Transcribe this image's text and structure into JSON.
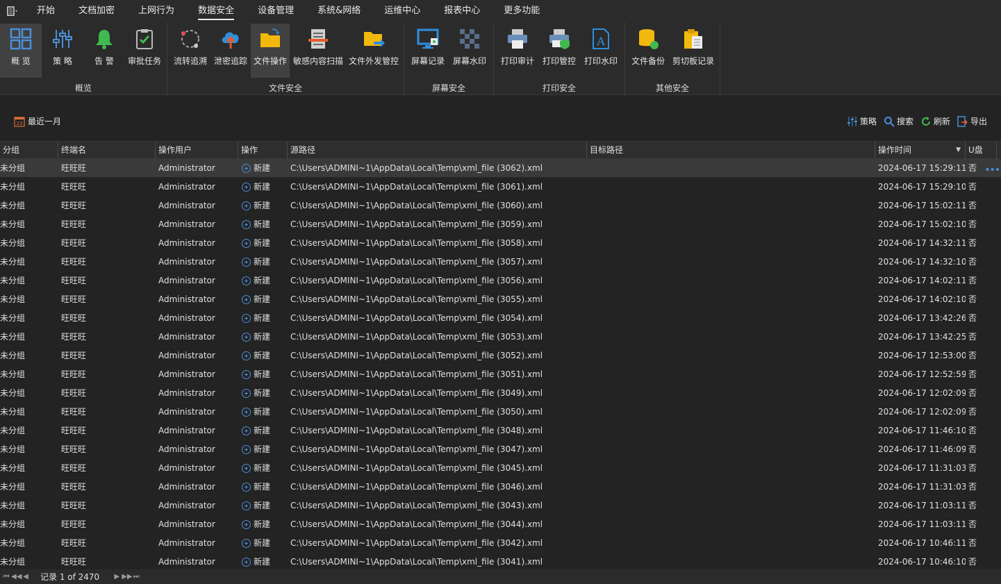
{
  "menubar": {
    "items": [
      "开始",
      "文档加密",
      "上网行为",
      "数据安全",
      "设备管理",
      "系统&网络",
      "运维中心",
      "报表中心",
      "更多功能"
    ],
    "active_index": 3
  },
  "ribbon": {
    "groups": [
      {
        "title": "概览"
      },
      {
        "title": "文件安全"
      },
      {
        "title": "屏幕安全"
      },
      {
        "title": "打印安全"
      },
      {
        "title": "其他安全"
      }
    ],
    "buttons": {
      "overview": "概 览",
      "policy": "策 略",
      "alert": "告 警",
      "approval": "审批任务",
      "flow_trace": "流转追溯",
      "leak_trace": "泄密追踪",
      "file_ops": "文件操作",
      "sensitive_scan": "敏感内容扫描",
      "file_outbound": "文件外发管控",
      "screen_record": "屏幕记录",
      "screen_watermark": "屏幕水印",
      "print_audit": "打印审计",
      "print_control": "打印管控",
      "print_watermark": "打印水印",
      "file_backup": "文件备份",
      "clipboard": "剪切板记录"
    }
  },
  "toolbar": {
    "date_range": "最近一月",
    "calendar_day": "23",
    "policy": "策略",
    "search": "搜索",
    "refresh": "刷新",
    "export": "导出"
  },
  "table": {
    "columns": [
      "分组",
      "终端名",
      "操作用户",
      "操作",
      "源路径",
      "目标路径",
      "操作时间",
      "U盘"
    ],
    "rows": [
      {
        "group": "未分组",
        "terminal": "旺旺旺",
        "user": "Administrator",
        "op": "新建",
        "src": "C:\\Users\\ADMINI~1\\AppData\\Local\\Temp\\xml_file (3062).xml",
        "dst": "",
        "time": "2024-06-17 15:29:11",
        "usb": "否"
      },
      {
        "group": "未分组",
        "terminal": "旺旺旺",
        "user": "Administrator",
        "op": "新建",
        "src": "C:\\Users\\ADMINI~1\\AppData\\Local\\Temp\\xml_file (3061).xml",
        "dst": "",
        "time": "2024-06-17 15:29:10",
        "usb": "否"
      },
      {
        "group": "未分组",
        "terminal": "旺旺旺",
        "user": "Administrator",
        "op": "新建",
        "src": "C:\\Users\\ADMINI~1\\AppData\\Local\\Temp\\xml_file (3060).xml",
        "dst": "",
        "time": "2024-06-17 15:02:11",
        "usb": "否"
      },
      {
        "group": "未分组",
        "terminal": "旺旺旺",
        "user": "Administrator",
        "op": "新建",
        "src": "C:\\Users\\ADMINI~1\\AppData\\Local\\Temp\\xml_file (3059).xml",
        "dst": "",
        "time": "2024-06-17 15:02:10",
        "usb": "否"
      },
      {
        "group": "未分组",
        "terminal": "旺旺旺",
        "user": "Administrator",
        "op": "新建",
        "src": "C:\\Users\\ADMINI~1\\AppData\\Local\\Temp\\xml_file (3058).xml",
        "dst": "",
        "time": "2024-06-17 14:32:11",
        "usb": "否"
      },
      {
        "group": "未分组",
        "terminal": "旺旺旺",
        "user": "Administrator",
        "op": "新建",
        "src": "C:\\Users\\ADMINI~1\\AppData\\Local\\Temp\\xml_file (3057).xml",
        "dst": "",
        "time": "2024-06-17 14:32:10",
        "usb": "否"
      },
      {
        "group": "未分组",
        "terminal": "旺旺旺",
        "user": "Administrator",
        "op": "新建",
        "src": "C:\\Users\\ADMINI~1\\AppData\\Local\\Temp\\xml_file (3056).xml",
        "dst": "",
        "time": "2024-06-17 14:02:11",
        "usb": "否"
      },
      {
        "group": "未分组",
        "terminal": "旺旺旺",
        "user": "Administrator",
        "op": "新建",
        "src": "C:\\Users\\ADMINI~1\\AppData\\Local\\Temp\\xml_file (3055).xml",
        "dst": "",
        "time": "2024-06-17 14:02:10",
        "usb": "否"
      },
      {
        "group": "未分组",
        "terminal": "旺旺旺",
        "user": "Administrator",
        "op": "新建",
        "src": "C:\\Users\\ADMINI~1\\AppData\\Local\\Temp\\xml_file (3054).xml",
        "dst": "",
        "time": "2024-06-17 13:42:26",
        "usb": "否"
      },
      {
        "group": "未分组",
        "terminal": "旺旺旺",
        "user": "Administrator",
        "op": "新建",
        "src": "C:\\Users\\ADMINI~1\\AppData\\Local\\Temp\\xml_file (3053).xml",
        "dst": "",
        "time": "2024-06-17 13:42:25",
        "usb": "否"
      },
      {
        "group": "未分组",
        "terminal": "旺旺旺",
        "user": "Administrator",
        "op": "新建",
        "src": "C:\\Users\\ADMINI~1\\AppData\\Local\\Temp\\xml_file (3052).xml",
        "dst": "",
        "time": "2024-06-17 12:53:00",
        "usb": "否"
      },
      {
        "group": "未分组",
        "terminal": "旺旺旺",
        "user": "Administrator",
        "op": "新建",
        "src": "C:\\Users\\ADMINI~1\\AppData\\Local\\Temp\\xml_file (3051).xml",
        "dst": "",
        "time": "2024-06-17 12:52:59",
        "usb": "否"
      },
      {
        "group": "未分组",
        "terminal": "旺旺旺",
        "user": "Administrator",
        "op": "新建",
        "src": "C:\\Users\\ADMINI~1\\AppData\\Local\\Temp\\xml_file (3049).xml",
        "dst": "",
        "time": "2024-06-17 12:02:09",
        "usb": "否"
      },
      {
        "group": "未分组",
        "terminal": "旺旺旺",
        "user": "Administrator",
        "op": "新建",
        "src": "C:\\Users\\ADMINI~1\\AppData\\Local\\Temp\\xml_file (3050).xml",
        "dst": "",
        "time": "2024-06-17 12:02:09",
        "usb": "否"
      },
      {
        "group": "未分组",
        "terminal": "旺旺旺",
        "user": "Administrator",
        "op": "新建",
        "src": "C:\\Users\\ADMINI~1\\AppData\\Local\\Temp\\xml_file (3048).xml",
        "dst": "",
        "time": "2024-06-17 11:46:10",
        "usb": "否"
      },
      {
        "group": "未分组",
        "terminal": "旺旺旺",
        "user": "Administrator",
        "op": "新建",
        "src": "C:\\Users\\ADMINI~1\\AppData\\Local\\Temp\\xml_file (3047).xml",
        "dst": "",
        "time": "2024-06-17 11:46:09",
        "usb": "否"
      },
      {
        "group": "未分组",
        "terminal": "旺旺旺",
        "user": "Administrator",
        "op": "新建",
        "src": "C:\\Users\\ADMINI~1\\AppData\\Local\\Temp\\xml_file (3045).xml",
        "dst": "",
        "time": "2024-06-17 11:31:03",
        "usb": "否"
      },
      {
        "group": "未分组",
        "terminal": "旺旺旺",
        "user": "Administrator",
        "op": "新建",
        "src": "C:\\Users\\ADMINI~1\\AppData\\Local\\Temp\\xml_file (3046).xml",
        "dst": "",
        "time": "2024-06-17 11:31:03",
        "usb": "否"
      },
      {
        "group": "未分组",
        "terminal": "旺旺旺",
        "user": "Administrator",
        "op": "新建",
        "src": "C:\\Users\\ADMINI~1\\AppData\\Local\\Temp\\xml_file (3043).xml",
        "dst": "",
        "time": "2024-06-17 11:03:11",
        "usb": "否"
      },
      {
        "group": "未分组",
        "terminal": "旺旺旺",
        "user": "Administrator",
        "op": "新建",
        "src": "C:\\Users\\ADMINI~1\\AppData\\Local\\Temp\\xml_file (3044).xml",
        "dst": "",
        "time": "2024-06-17 11:03:11",
        "usb": "否"
      },
      {
        "group": "未分组",
        "terminal": "旺旺旺",
        "user": "Administrator",
        "op": "新建",
        "src": "C:\\Users\\ADMINI~1\\AppData\\Local\\Temp\\xml_file (3042).xml",
        "dst": "",
        "time": "2024-06-17 10:46:11",
        "usb": "否"
      },
      {
        "group": "未分组",
        "terminal": "旺旺旺",
        "user": "Administrator",
        "op": "新建",
        "src": "C:\\Users\\ADMINI~1\\AppData\\Local\\Temp\\xml_file (3041).xml",
        "dst": "",
        "time": "2024-06-17 10:46:10",
        "usb": "否"
      }
    ]
  },
  "pager": {
    "first": "⏮",
    "prev_page": "◀◀",
    "prev": "◀",
    "label": "记录 1 of 2470",
    "next": "▶",
    "next_page": "▶▶",
    "last": "⏭"
  },
  "colors": {
    "background": "#232323",
    "accent_blue": "#4a90d9",
    "icon_green": "#3fb950",
    "icon_yellow": "#f2b90c"
  }
}
